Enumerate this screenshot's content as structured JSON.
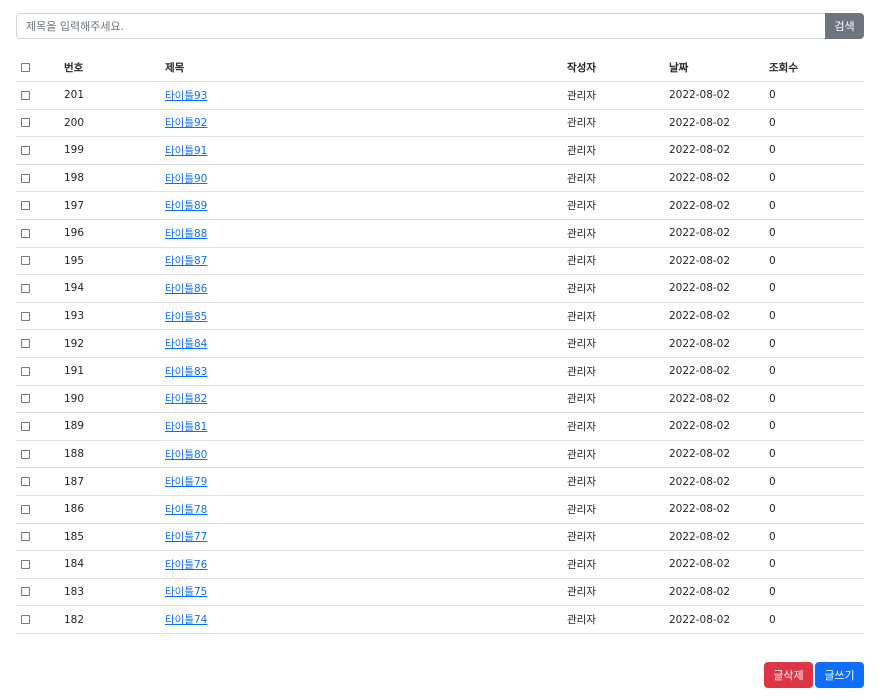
{
  "search": {
    "placeholder": "제목을 입력해주세요.",
    "button_label": "검색"
  },
  "table": {
    "headers": {
      "number": "번호",
      "title": "제목",
      "author": "작성자",
      "date": "날짜",
      "views": "조회수"
    },
    "rows": [
      {
        "number": "201",
        "title": "타이틀93",
        "author": "관리자",
        "date": "2022-08-02",
        "views": "0"
      },
      {
        "number": "200",
        "title": "타이틀92",
        "author": "관리자",
        "date": "2022-08-02",
        "views": "0"
      },
      {
        "number": "199",
        "title": "타이틀91",
        "author": "관리자",
        "date": "2022-08-02",
        "views": "0"
      },
      {
        "number": "198",
        "title": "타이틀90",
        "author": "관리자",
        "date": "2022-08-02",
        "views": "0"
      },
      {
        "number": "197",
        "title": "타이틀89",
        "author": "관리자",
        "date": "2022-08-02",
        "views": "0"
      },
      {
        "number": "196",
        "title": "타이틀88",
        "author": "관리자",
        "date": "2022-08-02",
        "views": "0"
      },
      {
        "number": "195",
        "title": "타이틀87",
        "author": "관리자",
        "date": "2022-08-02",
        "views": "0"
      },
      {
        "number": "194",
        "title": "타이틀86",
        "author": "관리자",
        "date": "2022-08-02",
        "views": "0"
      },
      {
        "number": "193",
        "title": "타이틀85",
        "author": "관리자",
        "date": "2022-08-02",
        "views": "0"
      },
      {
        "number": "192",
        "title": "타이틀84",
        "author": "관리자",
        "date": "2022-08-02",
        "views": "0"
      },
      {
        "number": "191",
        "title": "타이틀83",
        "author": "관리자",
        "date": "2022-08-02",
        "views": "0"
      },
      {
        "number": "190",
        "title": "타이틀82",
        "author": "관리자",
        "date": "2022-08-02",
        "views": "0"
      },
      {
        "number": "189",
        "title": "타이틀81",
        "author": "관리자",
        "date": "2022-08-02",
        "views": "0"
      },
      {
        "number": "188",
        "title": "타이틀80",
        "author": "관리자",
        "date": "2022-08-02",
        "views": "0"
      },
      {
        "number": "187",
        "title": "타이틀79",
        "author": "관리자",
        "date": "2022-08-02",
        "views": "0"
      },
      {
        "number": "186",
        "title": "타이틀78",
        "author": "관리자",
        "date": "2022-08-02",
        "views": "0"
      },
      {
        "number": "185",
        "title": "타이틀77",
        "author": "관리자",
        "date": "2022-08-02",
        "views": "0"
      },
      {
        "number": "184",
        "title": "타이틀76",
        "author": "관리자",
        "date": "2022-08-02",
        "views": "0"
      },
      {
        "number": "183",
        "title": "타이틀75",
        "author": "관리자",
        "date": "2022-08-02",
        "views": "0"
      },
      {
        "number": "182",
        "title": "타이틀74",
        "author": "관리자",
        "date": "2022-08-02",
        "views": "0"
      }
    ]
  },
  "actions": {
    "delete_label": "글삭제",
    "write_label": "글쓰기"
  },
  "colors": {
    "search_button": "#6c757d",
    "delete_button": "#dc3545",
    "write_button": "#0d6efd",
    "link": "#0d6efd"
  }
}
